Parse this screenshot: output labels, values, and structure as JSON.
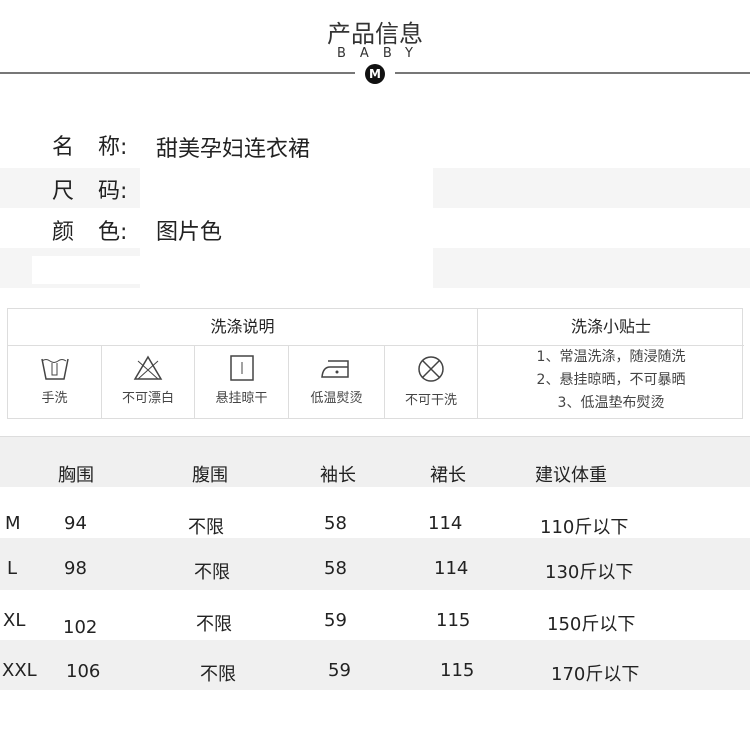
{
  "header": {
    "title": "产品信息",
    "subtitle": "BABY",
    "logo": "M"
  },
  "info": [
    {
      "label_a": "名",
      "label_b": "称:",
      "value": "甜美孕妇连衣裙"
    },
    {
      "label_a": "尺",
      "label_b": "码:",
      "value": ""
    },
    {
      "label_a": "颜",
      "label_b": "色:",
      "value": "图片色"
    }
  ],
  "wash": {
    "title": "洗涤说明",
    "tips_title": "洗涤小贴士",
    "icons": [
      {
        "icon": "hand-wash-icon",
        "label": "手洗"
      },
      {
        "icon": "no-bleach-icon",
        "label": "不可漂白"
      },
      {
        "icon": "hang-dry-icon",
        "label": "悬挂晾干"
      },
      {
        "icon": "low-iron-icon",
        "label": "低温熨烫"
      },
      {
        "icon": "no-dry-clean-icon",
        "label": "不可干洗"
      }
    ],
    "tips": [
      "1、常温洗涤，随浸随洗",
      "2、悬挂晾晒，不可暴晒",
      "3、低温垫布熨烫"
    ]
  },
  "sizes": {
    "headers": [
      "胸围",
      "腹围",
      "袖长",
      "裙长",
      "建议体重"
    ],
    "rows": [
      {
        "size": "M",
        "chest": "94",
        "waist": "不限",
        "sleeve": "58",
        "length": "114",
        "weight": "110斤以下"
      },
      {
        "size": "L",
        "chest": "98",
        "waist": "不限",
        "sleeve": "58",
        "length": "114",
        "weight": "130斤以下"
      },
      {
        "size": "XL",
        "chest": "102",
        "waist": "不限",
        "sleeve": "59",
        "length": "115",
        "weight": "150斤以下"
      },
      {
        "size": "XXL",
        "chest": "106",
        "waist": "不限",
        "sleeve": "59",
        "length": "115",
        "weight": "170斤以下"
      }
    ]
  }
}
